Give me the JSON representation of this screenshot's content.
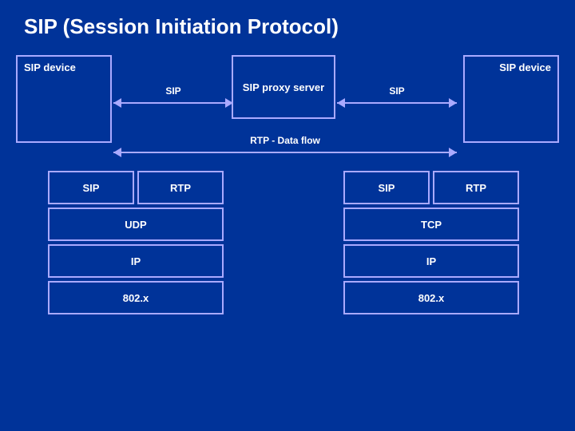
{
  "title": "SIP (Session Initiation Protocol)",
  "proxy": {
    "label": "SIP proxy server"
  },
  "left_device": {
    "label": "SIP device"
  },
  "right_device": {
    "label": "SIP device"
  },
  "sip_left_arrow": {
    "label": "SIP"
  },
  "sip_right_arrow": {
    "label": "SIP"
  },
  "rtp_arrow": {
    "label": "RTP - Data flow"
  },
  "left_stack": {
    "row1": [
      "SIP",
      "RTP"
    ],
    "row2": "UDP",
    "row3": "IP",
    "row4": "802.x"
  },
  "right_stack": {
    "row1": [
      "SIP",
      "RTP"
    ],
    "row2": "TCP",
    "row3": "IP",
    "row4": "802.x"
  }
}
